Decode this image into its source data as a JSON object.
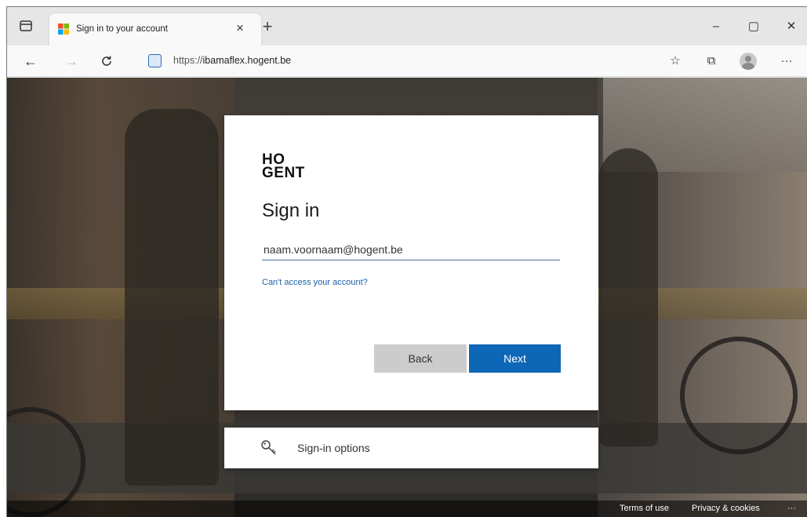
{
  "browser": {
    "tab": {
      "title": "Sign in to your account",
      "close": "×"
    },
    "new_tab": "+",
    "window_controls": {
      "minimize": "–",
      "maximize": "▢",
      "close": "✕"
    },
    "nav": {
      "back": "←",
      "forward": "→",
      "refresh": "C"
    },
    "address": {
      "scheme": "https://",
      "host": "ibamaflex.hogent.be"
    },
    "toolbar_icons": {
      "favorites": "☆",
      "collections": "⧉",
      "menu": "···"
    }
  },
  "signin": {
    "logo_line1": "HO",
    "logo_line2": "GENT",
    "heading": "Sign in",
    "email_value": "naam.voornaam@hogent.be",
    "cant_access": "Can't access your account?",
    "back_label": "Back",
    "next_label": "Next",
    "options_label": "Sign-in options"
  },
  "footer": {
    "terms": "Terms of use",
    "privacy": "Privacy & cookies",
    "more": "···"
  },
  "colors": {
    "accent": "#0d67b6",
    "link": "#1d5fa6",
    "back_button": "#cccccc"
  },
  "icons": {
    "tab_actions": "tab-actions-icon",
    "favicon": "microsoft-logo-icon",
    "site": "site-info-icon",
    "key": "key-icon",
    "profile": "avatar"
  }
}
